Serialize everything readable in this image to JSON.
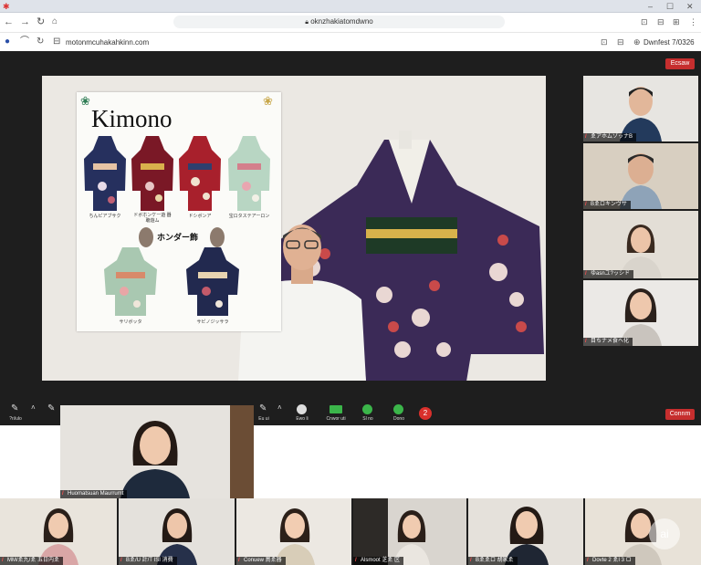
{
  "browser": {
    "address": "oknzhakiatomdwno",
    "second_bar_url": "motonmcuhakahkinn.com",
    "second_bar_right": "Dwnfest 7/0326"
  },
  "meeting": {
    "top_right_button": "Ecsaw",
    "end_button": "Connm",
    "badge_count": "2",
    "controls": [
      {
        "label": "?ri/ulo"
      },
      {
        "label": "Eu ui"
      },
      {
        "label": "Ewo li"
      },
      {
        "label": "Cnwor uti"
      },
      {
        "label": "Sl no"
      },
      {
        "label": "Dono"
      }
    ]
  },
  "presentation": {
    "poster_title": "Kimono",
    "poster_heading": "ホンダー飾",
    "captions": [
      "ちんピアブサク",
      "ドボホンケー遊 \n 器聴遊ム",
      "ドシボンア",
      "宝ロタステアーロン",
      "サリボッタ",
      "サビノジッサラ"
    ]
  },
  "participants_side": [
    {
      "name": "ゑアホムゾッナB"
    },
    {
      "name": "Bゑロキンヴサ"
    },
    {
      "name": "ゆasnユ?ッシド"
    },
    {
      "name": "目ちナメ食ヘ化"
    }
  ],
  "participant_large": {
    "name": "Huomatsuan Maurrumt"
  },
  "participants_bottom": [
    {
      "name": "MM/ゑ九/ゑ 五日内ゑ"
    },
    {
      "name": "Bゑ/U 計/T ISI 消費"
    },
    {
      "name": "Conuew 鳥ゑ器"
    },
    {
      "name": "Alsmoot 芝ゑ 区"
    },
    {
      "name": "Bゑゑロ 胡家ゑ"
    },
    {
      "name": "Dovte 2 ゑI 3 ロ"
    }
  ],
  "colors": {
    "accent_red": "#c62e2e",
    "green": "#3bb54a",
    "chrome_bg": "#ffffff"
  }
}
